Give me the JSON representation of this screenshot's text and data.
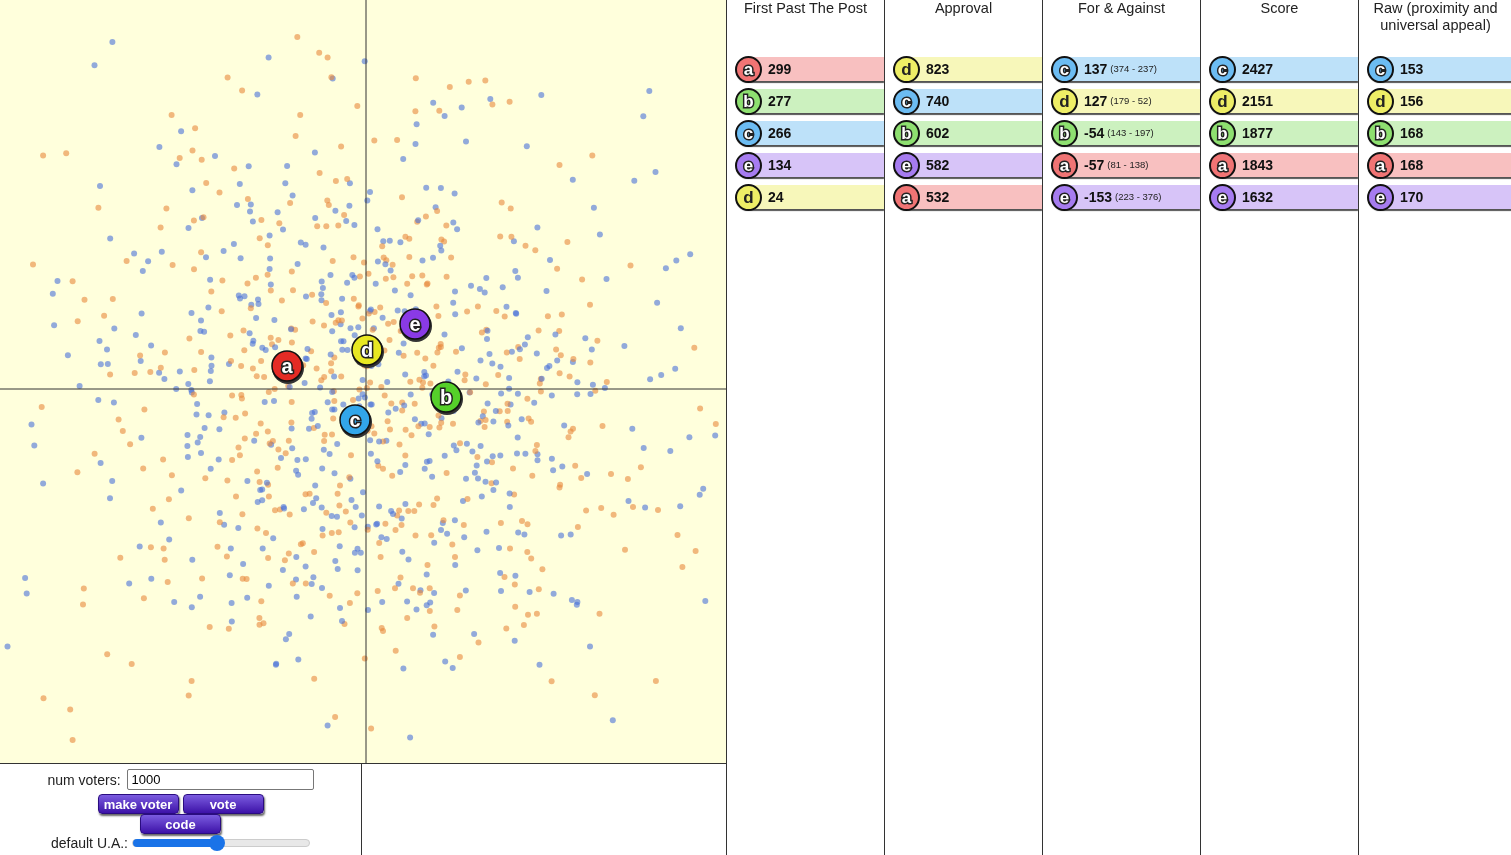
{
  "candidates": [
    {
      "label": "a",
      "color": "#e42b25"
    },
    {
      "label": "b",
      "color": "#55d02a"
    },
    {
      "label": "c",
      "color": "#32a6ea"
    },
    {
      "label": "d",
      "color": "#e8e822"
    },
    {
      "label": "e",
      "color": "#8a3ae6"
    }
  ],
  "controls": {
    "num_voters_label": "num voters:",
    "num_voters_value": "1000",
    "buttons": [
      "make voter",
      "vote",
      "code"
    ],
    "ua_slider": {
      "label": "default U.A.:",
      "level": 0.48
    }
  },
  "results": [
    {
      "title": "First Past The Post",
      "rows": [
        {
          "candidate": "a",
          "color": "#f07474",
          "score": "299"
        },
        {
          "candidate": "b",
          "color": "#8ee070",
          "score": "277"
        },
        {
          "candidate": "c",
          "color": "#6cbcf2",
          "score": "266"
        },
        {
          "candidate": "e",
          "color": "#a67cf0",
          "score": "134"
        },
        {
          "candidate": "d",
          "color": "#eeee66",
          "score": "24"
        }
      ]
    },
    {
      "title": "Approval",
      "rows": [
        {
          "candidate": "d",
          "color": "#eeee66",
          "score": "823"
        },
        {
          "candidate": "c",
          "color": "#6cbcf2",
          "score": "740"
        },
        {
          "candidate": "b",
          "color": "#8ee070",
          "score": "602"
        },
        {
          "candidate": "e",
          "color": "#a67cf0",
          "score": "582"
        },
        {
          "candidate": "a",
          "color": "#f07474",
          "score": "532"
        }
      ]
    },
    {
      "title": "For & Against",
      "rows": [
        {
          "candidate": "c",
          "color": "#6cbcf2",
          "score": "137",
          "detail": "(374 - 237)"
        },
        {
          "candidate": "d",
          "color": "#eeee66",
          "score": "127",
          "detail": "(179 - 52)"
        },
        {
          "candidate": "b",
          "color": "#8ee070",
          "score": "-54",
          "detail": "(143 - 197)"
        },
        {
          "candidate": "a",
          "color": "#f07474",
          "score": "-57",
          "detail": "(81 - 138)"
        },
        {
          "candidate": "e",
          "color": "#a67cf0",
          "score": "-153",
          "detail": "(223 - 376)"
        }
      ]
    },
    {
      "title": "Score",
      "rows": [
        {
          "candidate": "c",
          "color": "#6cbcf2",
          "score": "2427"
        },
        {
          "candidate": "d",
          "color": "#eeee66",
          "score": "2151"
        },
        {
          "candidate": "b",
          "color": "#8ee070",
          "score": "1877"
        },
        {
          "candidate": "a",
          "color": "#f07474",
          "score": "1843"
        },
        {
          "candidate": "e",
          "color": "#a67cf0",
          "score": "1632"
        }
      ]
    },
    {
      "title": "Raw (proximity and universal appeal)",
      "rows": [
        {
          "candidate": "c",
          "color": "#6cbcf2",
          "score": "153"
        },
        {
          "candidate": "d",
          "color": "#eeee66",
          "score": "156"
        },
        {
          "candidate": "b",
          "color": "#8ee070",
          "score": "168"
        },
        {
          "candidate": "a",
          "color": "#f07474",
          "score": "168"
        },
        {
          "candidate": "e",
          "color": "#a67cf0",
          "score": "170"
        }
      ]
    }
  ]
}
